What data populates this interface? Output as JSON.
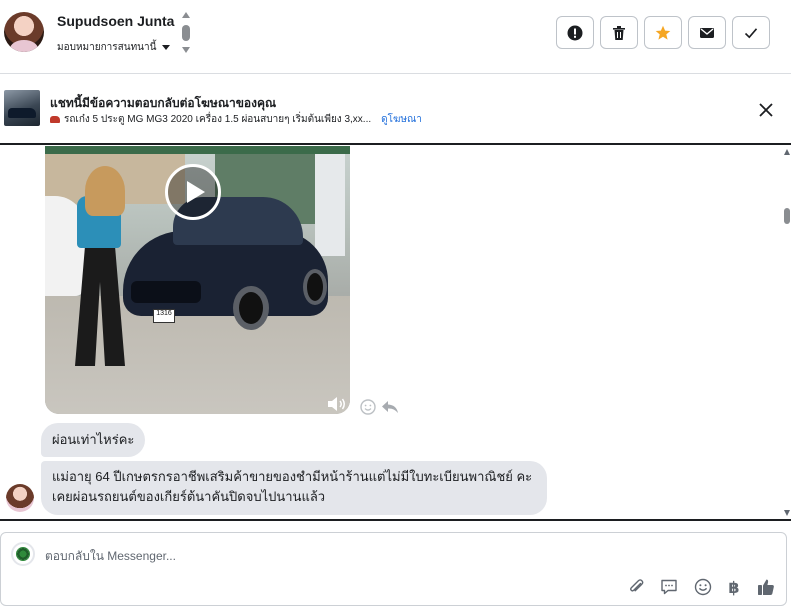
{
  "header": {
    "user_name": "Supudsoen Junta",
    "assign_label": "มอบหมายการสนทนานี้",
    "actions": [
      {
        "name": "report-icon",
        "color": "#1c1e21"
      },
      {
        "name": "trash-icon",
        "color": "#1c1e21"
      },
      {
        "name": "star-icon",
        "color": "#f5a623"
      },
      {
        "name": "mail-icon",
        "color": "#1c1e21"
      },
      {
        "name": "check-icon",
        "color": "#1c1e21"
      }
    ]
  },
  "banner": {
    "title": "แชทนี้มีข้อความตอบกลับต่อโฆษณาของคุณ",
    "subtitle": "รถเก๋ง 5 ประตู MG MG3 2020 เครื่อง 1.5 ผ่อนสบายๆ เริ่มต้นเพียง 3,xx...",
    "link": "ดูโฆษณา"
  },
  "conversation": {
    "video_plate": "1316",
    "messages": [
      {
        "text": "ผ่อนเท่าไหร่คะ"
      },
      {
        "text": "แม่อายุ 64 ปีเกษตรกรอาชีพเสริมค้าขายของชำมีหน้าร้านแต่ไม่มีใบทะเบียนพาณิชย์ คะเคยผ่อนรถยนต์ของเกียร์ต้นาคันปิดจบไปนานแล้ว"
      }
    ]
  },
  "composer": {
    "placeholder": "ตอบกลับใน Messenger...",
    "currency_symbol": "฿",
    "icons": [
      "paperclip-icon",
      "chat-bubble-icon",
      "emoji-icon",
      "baht-icon",
      "thumbs-up-icon"
    ]
  },
  "colors": {
    "accent_link": "#216fdb",
    "star": "#f5a623",
    "bubble": "#e4e6eb"
  }
}
